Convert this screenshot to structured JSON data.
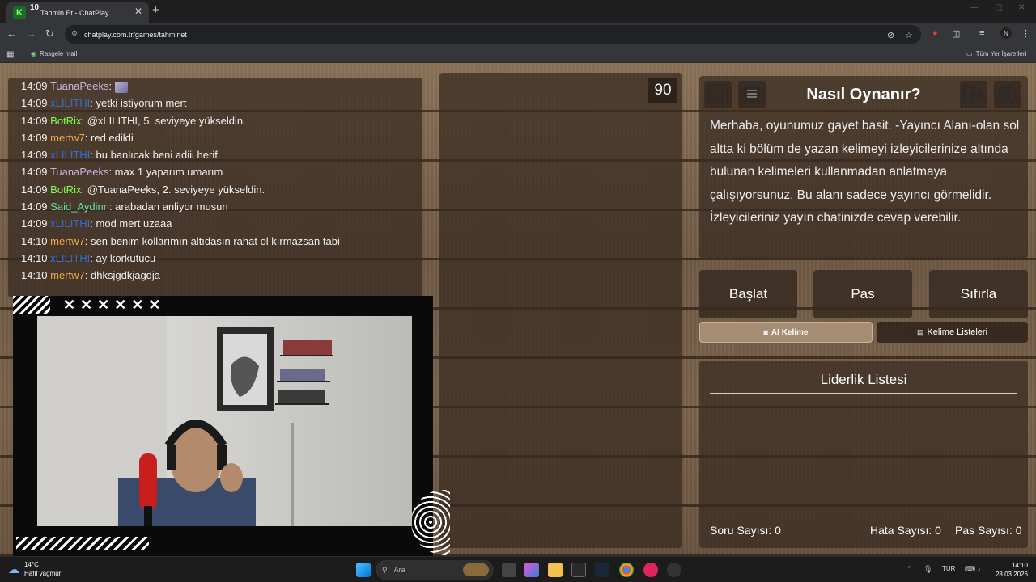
{
  "browser": {
    "tab_title": "Tahmin Et - ChatPlay",
    "favicon_badge": "10",
    "url": "chatplay.com.tr/games/tahminet",
    "bookmark_left": "Rasgele mail",
    "bookmark_right": "Tüm Yer İşaretleri",
    "profile_initial": "N"
  },
  "chat": {
    "messages": [
      {
        "time": "14:09",
        "user": "TuanaPeeks",
        "color": "#c8b3e0",
        "text": ""
      },
      {
        "time": "14:09",
        "user": "xLILITHI",
        "color": "#2f6fd6",
        "text": ": yetki istiyorum mert"
      },
      {
        "time": "14:09",
        "user": "BotRix",
        "color": "#7cff4a",
        "text": ": @xLILITHI, 5. seviyeye yükseldin."
      },
      {
        "time": "14:09",
        "user": "mertw7",
        "color": "#f0a94a",
        "text": ": red edildi"
      },
      {
        "time": "14:09",
        "user": "xLILITHI",
        "color": "#2f6fd6",
        "text": ": bu banlıcak beni adiii herif"
      },
      {
        "time": "14:09",
        "user": "TuanaPeeks",
        "color": "#c8b3e0",
        "text": ": max 1 yaparım umarım"
      },
      {
        "time": "14:09",
        "user": "BotRix",
        "color": "#7cff4a",
        "text": ": @TuanaPeeks, 2. seviyeye yükseldin."
      },
      {
        "time": "14:09",
        "user": "Said_Aydinn",
        "color": "#5fe0b0",
        "text": ": arabadan anliyor musun"
      },
      {
        "time": "14:09",
        "user": "xLILITHI",
        "color": "#2f6fd6",
        "text": ": mod mert uzaaa"
      },
      {
        "time": "14:10",
        "user": "mertw7",
        "color": "#f0a94a",
        "text": ": sen benim kollarımın altıdasın rahat ol kırmazsan tabi"
      },
      {
        "time": "14:10",
        "user": "xLILITHI",
        "color": "#2f6fd6",
        "text": ": ay korkutucu"
      },
      {
        "time": "14:10",
        "user": "mertw7",
        "color": "#f0a94a",
        "text": ": dhksjgdkjagdja"
      }
    ]
  },
  "cam": {
    "x_marks": "✕✕✕✕✕✕"
  },
  "game": {
    "timer": "90",
    "howto_title": "Nasıl Oynanır?",
    "howto_text": "Merhaba, oyunumuz gayet basit. -Yayıncı Alanı-olan sol altta ki bölüm de yazan kelimeyi izleyicilerinize altında bulunan kelimeleri kullanmadan anlatmaya çalışıyorsunuz. Bu alanı sadece yayıncı görmelidir. İzleyicileriniz yayın chatinizde cevap verebilir.",
    "buttons": {
      "start": "Başlat",
      "pass": "Pas",
      "reset": "Sıfırla",
      "ai_word": "AI Kelime",
      "word_lists": "Kelime Listeleri"
    },
    "leaderboard_title": "Liderlik Listesi",
    "stats": {
      "questions": "Soru Sayısı: 0",
      "errors": "Hata Sayısı: 0",
      "passes": "Pas Sayısı: 0"
    }
  },
  "taskbar": {
    "weather_temp": "14°C",
    "weather_desc": "Hafif yağmur",
    "search_placeholder": "Ara",
    "lang": "TUR",
    "time": "14:10",
    "date": "28.03.2026"
  }
}
